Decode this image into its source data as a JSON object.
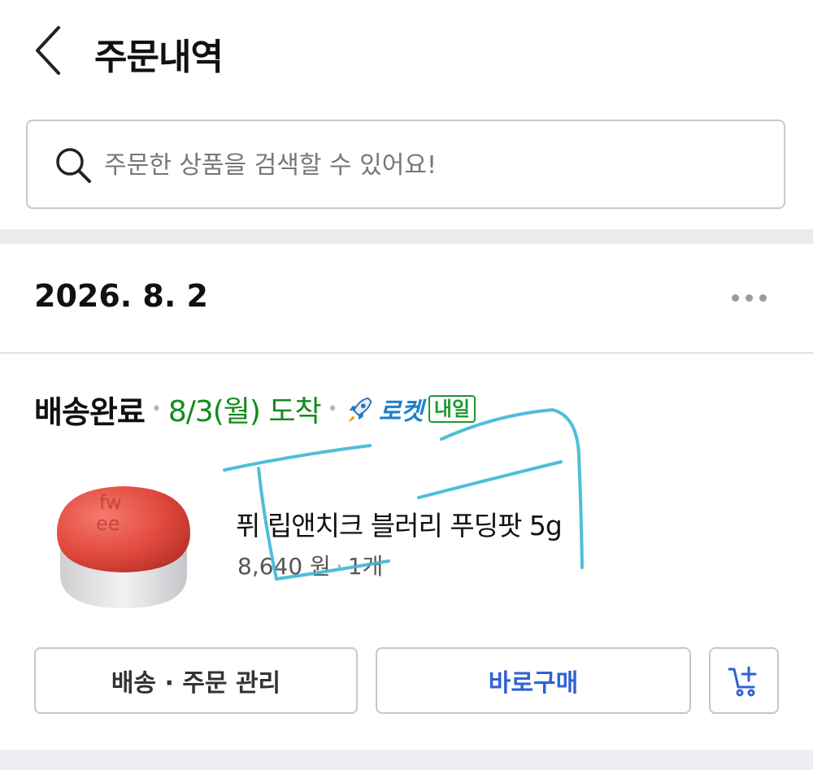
{
  "header": {
    "title": "주문내역"
  },
  "search": {
    "placeholder": "주문한 상품을 검색할 수 있어요!"
  },
  "order": {
    "date": "2026. 8. 2",
    "status": "배송완료",
    "arrival": "8/3(월) 도착",
    "rocket_label": "로켓",
    "rocket_badge": "내일",
    "product": {
      "name": "퓌 립앤치크 블러리 푸딩팟 5g",
      "price": "8,640 원",
      "quantity": "1개"
    },
    "actions": {
      "manage_label": "배송 · 주문 관리",
      "buy_label": "바로구매"
    }
  },
  "colors": {
    "arrival": "#138a1c",
    "rocket": "#1e7fcc",
    "buy_button": "#2f62d6",
    "doodle": "#3fb6d4"
  }
}
